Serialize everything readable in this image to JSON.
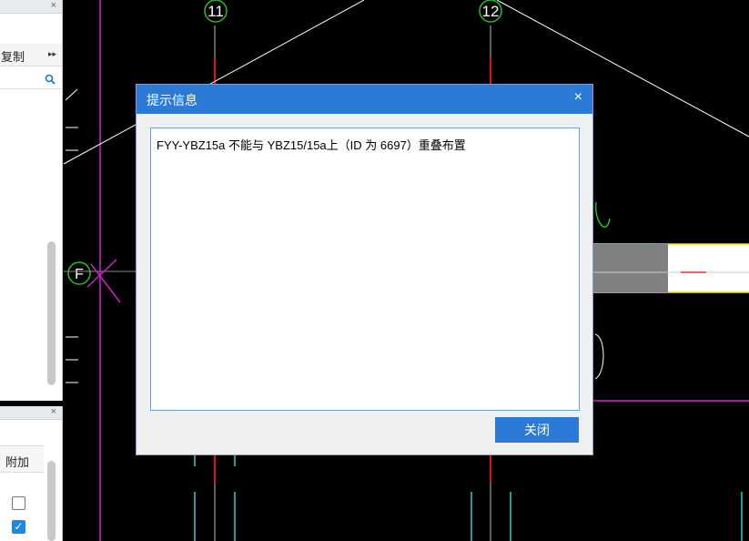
{
  "canvas": {
    "axis_label_1": "11",
    "axis_label_2": "12",
    "axis_label_f": "F"
  },
  "left_panel": {
    "close_glyph": "×",
    "toolbar_label": "复制",
    "expand_glyph": "▸▸"
  },
  "bottom_left_panel": {
    "close_glyph": "×",
    "column_header": "附加",
    "checkboxes": [
      {
        "checked": false
      },
      {
        "checked": true
      }
    ]
  },
  "dialog": {
    "title": "提示信息",
    "close_glyph": "×",
    "message": "FYY-YBZ15a 不能与 YBZ15/15a上（ID 为 6697）重叠布置",
    "close_button_label": "关闭"
  },
  "colors": {
    "dialog_title_bg": "#2b7ad8",
    "button_bg": "#2b7ad8",
    "cad_background": "#000000"
  }
}
